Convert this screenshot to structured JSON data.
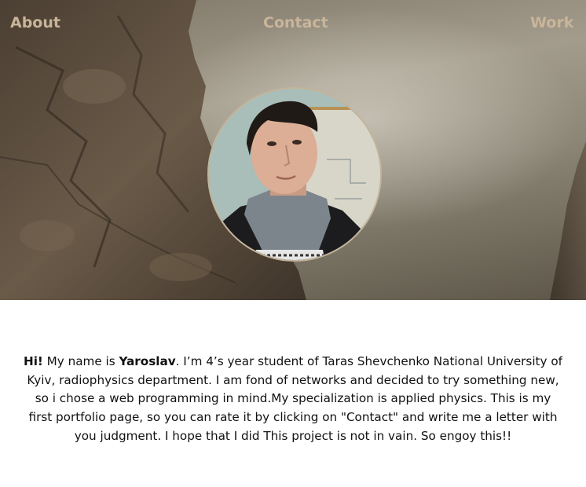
{
  "nav": {
    "about": "About",
    "contact": "Contact",
    "work": "Work"
  },
  "avatar": {
    "alt": "Yaroslav portrait photo"
  },
  "bio": {
    "greeting": "Hi!",
    "intro": " My name is ",
    "name": "Yaroslav",
    "text": ". I’m 4’s year student of Taras Shevchenko National University of Kyiv, radiophysics department. I am fond of networks and decided to try something new, so i chose a web programming in mind.My specialization is applied physics. This is my first portfolio page, so you can rate it by clicking on \"Contact\" and write me a letter with you judgment. I hope that I did This project is not in vain. So engoy this!!"
  },
  "colors": {
    "nav_text": "#c9b59a",
    "body_text": "#111111",
    "rock": "#5a4d3f",
    "sky": "#9e9787"
  }
}
